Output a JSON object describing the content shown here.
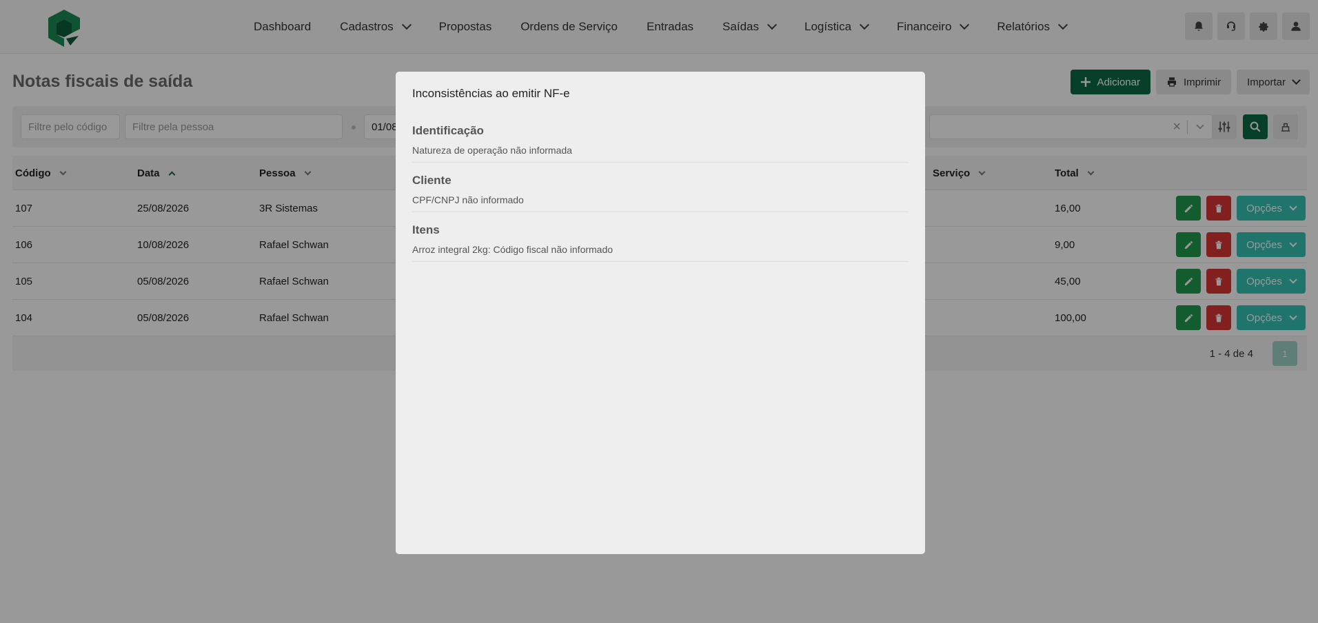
{
  "nav": {
    "items": [
      {
        "label": "Dashboard",
        "has_dropdown": false
      },
      {
        "label": "Cadastros",
        "has_dropdown": true
      },
      {
        "label": "Propostas",
        "has_dropdown": false
      },
      {
        "label": "Ordens de Serviço",
        "has_dropdown": false
      },
      {
        "label": "Entradas",
        "has_dropdown": false
      },
      {
        "label": "Saídas",
        "has_dropdown": true
      },
      {
        "label": "Logística",
        "has_dropdown": true
      },
      {
        "label": "Financeiro",
        "has_dropdown": true
      },
      {
        "label": "Relatórios",
        "has_dropdown": true
      }
    ],
    "icons": [
      "bell-icon",
      "headset-icon",
      "gear-icon",
      "user-icon"
    ]
  },
  "page": {
    "title": "Notas fiscais de saída",
    "actions": {
      "add_label": "Adicionar",
      "print_label": "Imprimir",
      "import_label": "Importar"
    }
  },
  "filters": {
    "code_placeholder": "Filtre pelo código",
    "person_placeholder": "Filtre pela pessoa",
    "date_value": "01/08"
  },
  "table": {
    "columns": {
      "codigo": "Código",
      "data": "Data",
      "pessoa": "Pessoa",
      "servico": "Serviço",
      "total": "Total"
    },
    "rows": [
      {
        "codigo": "107",
        "data": "25/08/2026",
        "pessoa": "3R Sistemas",
        "total": "16,00"
      },
      {
        "codigo": "106",
        "data": "10/08/2026",
        "pessoa": "Rafael Schwan",
        "total": "9,00"
      },
      {
        "codigo": "105",
        "data": "05/08/2026",
        "pessoa": "Rafael Schwan",
        "total": "45,00"
      },
      {
        "codigo": "104",
        "data": "05/08/2026",
        "pessoa": "Rafael Schwan",
        "total": "100,00"
      }
    ],
    "options_label": "Opções",
    "pagination": {
      "info": "1 - 4 de 4",
      "current_page": "1"
    }
  },
  "modal": {
    "title": "Inconsistências ao emitir NF-e",
    "sections": [
      {
        "title": "Identificação",
        "message": "Natureza de operação não informada"
      },
      {
        "title": "Cliente",
        "message": "CPF/CNPJ não informado"
      },
      {
        "title": "Itens",
        "message": "Arroz integral 2kg: Código fiscal não informado"
      }
    ]
  },
  "colors": {
    "brand": "#0a6b43",
    "edit": "#1f9a4c",
    "delete": "#d93535",
    "options": "#35c3b3"
  }
}
